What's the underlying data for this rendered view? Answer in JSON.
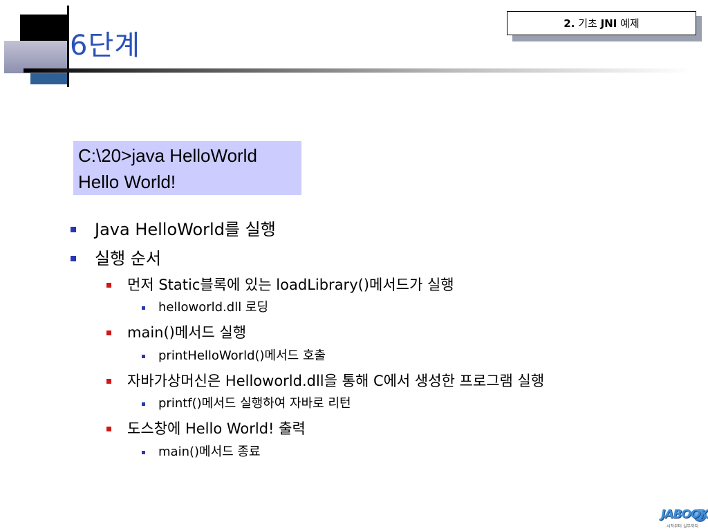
{
  "slide": {
    "title": "6단계",
    "header_number": "2.",
    "header_text_pre": "기초",
    "header_text_bold": "JNI",
    "header_text_post": "예제"
  },
  "console": {
    "lines": [
      "C:\\20>java HelloWorld",
      "Hello World!"
    ]
  },
  "outline": [
    {
      "level": 1,
      "text": "Java HelloWorld를 실행"
    },
    {
      "level": 1,
      "text": "실행 순서"
    },
    {
      "level": 2,
      "text": "먼저 Static블록에 있는 loadLibrary()메서드가 실행"
    },
    {
      "level": 3,
      "text": "helloworld.dll 로딩"
    },
    {
      "level": 2,
      "text": "main()메서드 실행"
    },
    {
      "level": 3,
      "text": "printHelloWorld()메서드 호출"
    },
    {
      "level": 2,
      "text": "자바가상머신은 Helloworld.dll을 통해 C에서 생성한 프로그램 실행"
    },
    {
      "level": 3,
      "text": "printf()메서드 실행하여 자바로 리턴"
    },
    {
      "level": 2,
      "text": "도스창에 Hello World! 출력"
    },
    {
      "level": 3,
      "text": "main()메서드 종료"
    }
  ],
  "logo": {
    "word": "JABOOK",
    "tagline": "시작부터 실무까지"
  },
  "colors": {
    "title": "#2a52b8",
    "console_background": "#ccccff",
    "bullet_level1": "#2b35b3",
    "bullet_level2": "#d11616",
    "bullet_level3": "#2b35b3"
  }
}
